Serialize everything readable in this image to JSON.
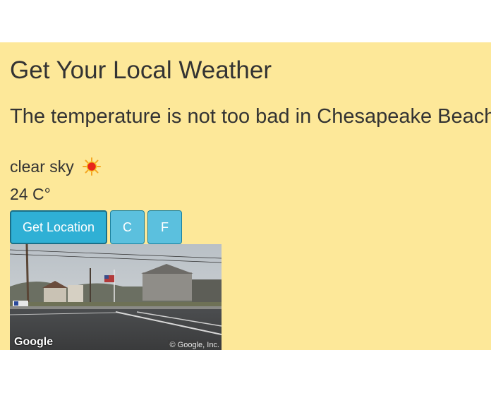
{
  "header": {
    "title": "Get Your Local Weather"
  },
  "weather": {
    "message": "The temperature is not too bad in Chesapeake Beach",
    "condition": "clear sky",
    "condition_icon": "sun-icon",
    "temperature": "24 C°"
  },
  "buttons": {
    "get_location_label": "Get Location",
    "celsius_label": "C",
    "fahrenheit_label": "F"
  },
  "street_view": {
    "logo_text": "Google",
    "copyright": "© Google, Inc."
  },
  "colors": {
    "background": "#fde899",
    "primary_button": "#2fb0d5",
    "info_button": "#5bc0de",
    "text": "#333333"
  }
}
